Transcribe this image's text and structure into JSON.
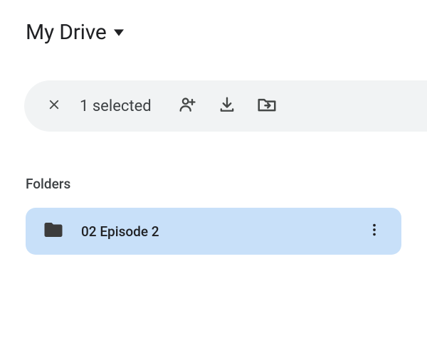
{
  "breadcrumb": {
    "title": "My Drive"
  },
  "selectionBar": {
    "count": "1 selected"
  },
  "section": {
    "heading": "Folders"
  },
  "folders": [
    {
      "name": "02 Episode 2"
    }
  ],
  "colors": {
    "selectedBg": "#c8e0f9",
    "barBg": "#f1f3f4",
    "text": "#202124",
    "icon": "#444746"
  }
}
